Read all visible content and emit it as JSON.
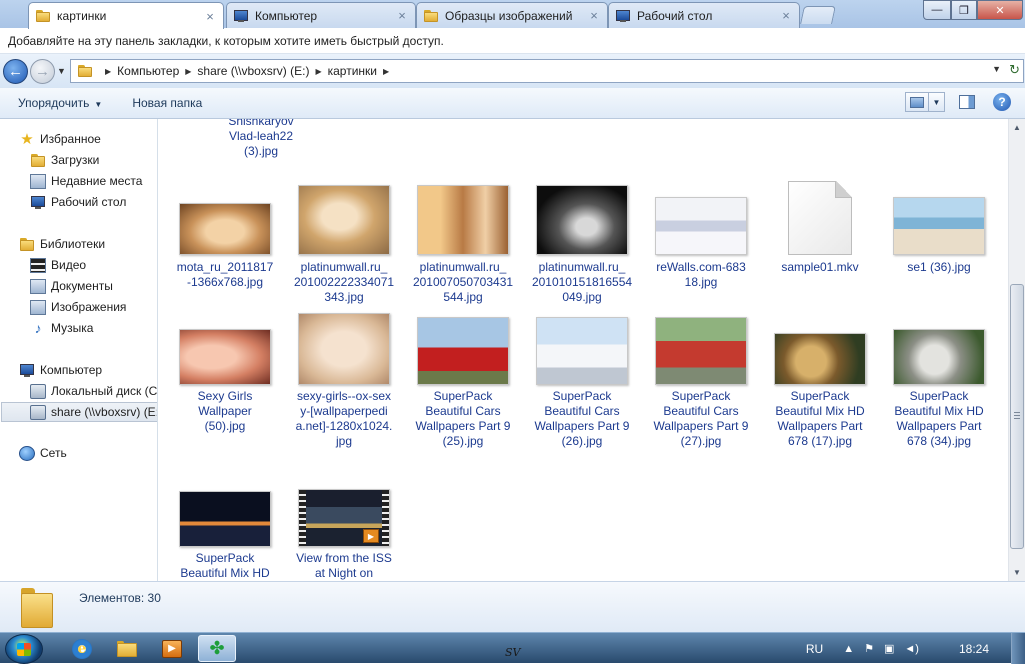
{
  "browser": {
    "tabs": [
      {
        "label": "картинки",
        "icon": "folder-icon",
        "active": true
      },
      {
        "label": "Компьютер",
        "icon": "computer-icon",
        "active": false
      },
      {
        "label": "Образцы изображений",
        "icon": "folder-icon",
        "active": false
      },
      {
        "label": "Рабочий стол",
        "icon": "desktop-icon",
        "active": false
      }
    ],
    "window_buttons": {
      "minimize": "—",
      "maximize": "❐",
      "close": "✕"
    }
  },
  "bookmarks_bar": {
    "text": "Добавляйте на эту панель закладки, к которым хотите иметь быстрый доступ."
  },
  "address": {
    "crumbs": [
      "Компьютер",
      "share (\\\\vboxsrv) (E:)",
      "картинки"
    ]
  },
  "command_bar": {
    "organize": "Упорядочить",
    "new_folder": "Новая папка"
  },
  "nav_pane": {
    "favorites": "Избранное",
    "downloads": "Загрузки",
    "recent": "Недавние места",
    "desktop": "Рабочий стол",
    "libraries": "Библиотеки",
    "video": "Видео",
    "documents": "Документы",
    "images": "Изображения",
    "music": "Музыка",
    "computer": "Компьютер",
    "local_disk": "Локальный диск (C",
    "share": "share (\\\\vboxsrv) (E:",
    "network": "Сеть"
  },
  "files": {
    "partial_top": "Shishkaryov\nVlad-leah22\n(3).jpg",
    "row1": [
      {
        "name": "mota_ru_2011817\n-1366x768.jpg"
      },
      {
        "name": "platinumwall.ru_\n201002222334071\n343.jpg"
      },
      {
        "name": "platinumwall.ru_\n201007050703431\n544.jpg"
      },
      {
        "name": "platinumwall.ru_\n201010151816554\n049.jpg"
      },
      {
        "name": "reWalls.com-683\n18.jpg"
      },
      {
        "name": "sample01.mkv"
      },
      {
        "name": "se1 (36).jpg"
      }
    ],
    "row2": [
      {
        "name": "Sexy Girls\nWallpaper\n(50).jpg"
      },
      {
        "name": "sexy-girls--ox-sex\ny-[wallpaperpedi\na.net]-1280x1024.\njpg"
      },
      {
        "name": "SuperPack\nBeautiful Cars\nWallpapers Part 9\n(25).jpg"
      },
      {
        "name": "SuperPack\nBeautiful Cars\nWallpapers Part 9\n(26).jpg"
      },
      {
        "name": "SuperPack\nBeautiful Cars\nWallpapers Part 9\n(27).jpg"
      },
      {
        "name": "SuperPack\nBeautiful Mix HD\nWallpapers Part\n678 (17).jpg"
      },
      {
        "name": "SuperPack\nBeautiful Mix HD\nWallpapers Part\n678 (34).jpg"
      }
    ],
    "row3": [
      {
        "name": "SuperPack\nBeautiful Mix HD"
      },
      {
        "name": "View from the ISS\nat Night on"
      }
    ]
  },
  "details": {
    "count": "Элементов: 30"
  },
  "taskbar": {
    "lang": "RU",
    "clock": "18:24",
    "watermark": "SV"
  }
}
